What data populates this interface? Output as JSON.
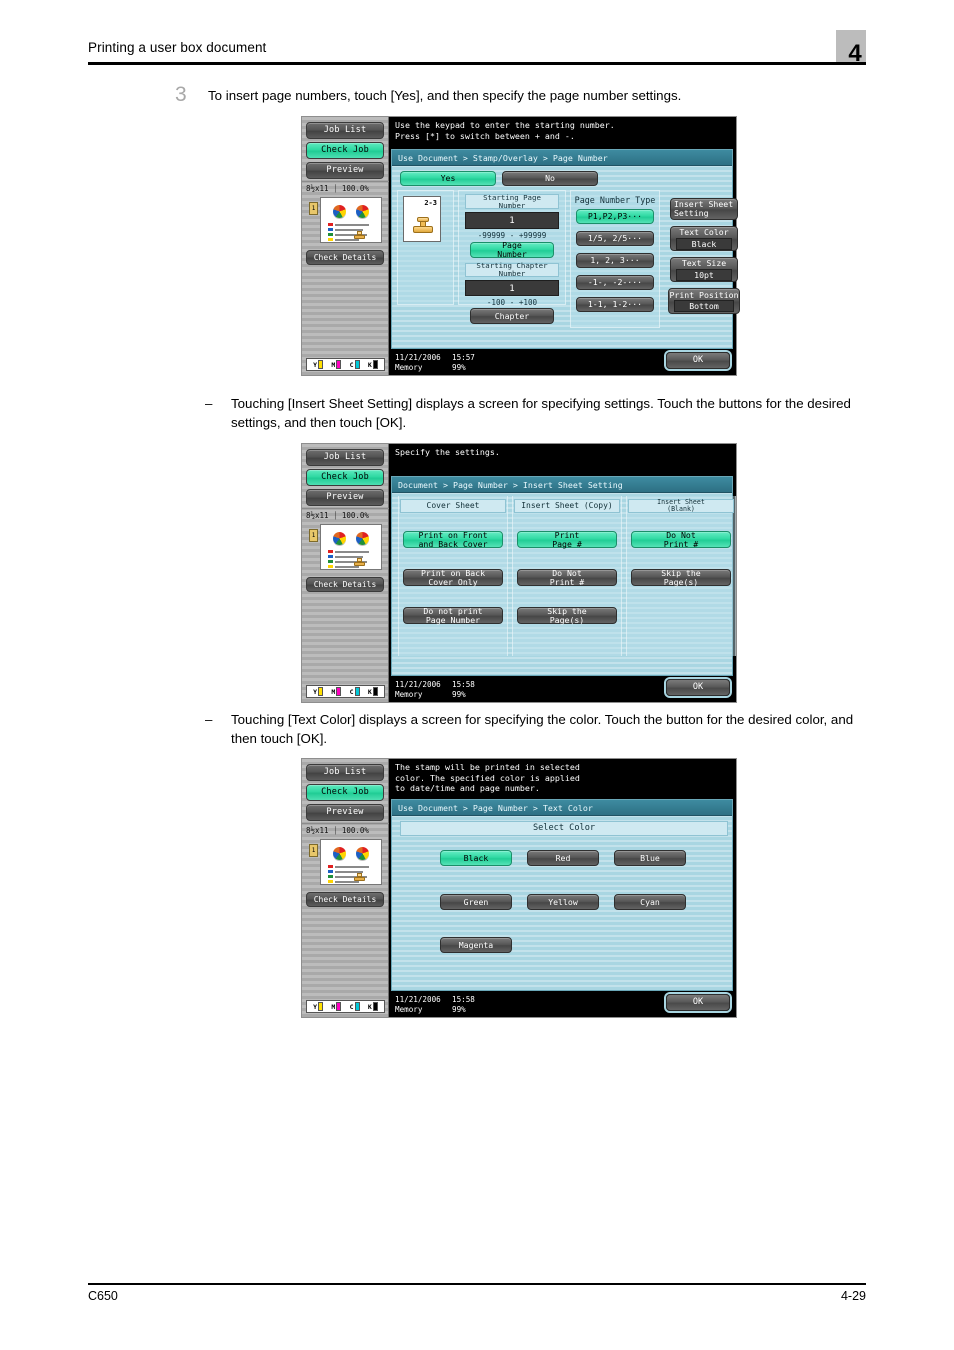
{
  "header": {
    "title": "Printing a user box document",
    "chapter": "4"
  },
  "footer": {
    "model": "C650",
    "page": "4-29"
  },
  "step": {
    "number": "3",
    "text": "To insert page numbers, touch [Yes], and then specify the page number settings."
  },
  "bullets": [
    {
      "dash": "–",
      "text": "Touching [Insert Sheet Setting] displays a screen for specifying settings. Touch the buttons for the desired settings, and then touch [OK]."
    },
    {
      "dash": "–",
      "text": "Touching [Text Color] displays a screen for specifying the color. Touch the button for the desired color, and then touch [OK]."
    }
  ],
  "colors": {
    "accent_green": "#2fd9a2",
    "lcd_background": "#a9d6e2",
    "breadcrumb_bar": "#3e8ba0",
    "button_gray": "#585858"
  },
  "rail": {
    "job_list": "Job List",
    "check_job": "Check Job",
    "preview": "Preview",
    "status": "8½x11 ⏐ 100.0%",
    "check_details": "Check Details",
    "toner": [
      {
        "label": "Y",
        "color": "#ffe000"
      },
      {
        "label": "M",
        "color": "#ff00c0"
      },
      {
        "label": "C",
        "color": "#00c8d8"
      },
      {
        "label": "K",
        "color": "#000000"
      }
    ]
  },
  "panel1": {
    "message": "Use the keypad to enter the starting number.\nPress [*] to switch between + and -.",
    "breadcrumb": "Use Document > Stamp/Overlay > Page Number",
    "yes": "Yes",
    "no": "No",
    "preview_page_label": "2-3",
    "starting_page_number_label": "Starting Page\nNumber",
    "starting_page_number_value": "1",
    "starting_page_number_range": "-99999  -  +99999",
    "page_number_button": "Page\nNumber",
    "starting_chapter_number_label": "Starting Chapter\nNumber",
    "starting_chapter_number_value": "1",
    "starting_chapter_number_range": "-100  -  +100",
    "chapter_button": "Chapter",
    "page_number_type_label": "Page Number Type",
    "page_number_types": [
      "P1,P2,P3···",
      "1/5, 2/5···",
      "1, 2, 3···",
      "-1-, -2-···",
      "1-1, 1-2···"
    ],
    "selected_page_number_type": "P1,P2,P3···",
    "insert_sheet_setting": "Insert Sheet\nSetting",
    "text_color_label": "Text Color",
    "text_color_value": "Black",
    "text_size_label": "Text Size",
    "text_size_value": "10pt",
    "print_position_label": "Print Position",
    "print_position_value": "Bottom",
    "date": "11/21/2006",
    "time": "15:57",
    "memory_label": "Memory",
    "memory_value": "99%",
    "ok": "OK"
  },
  "panel2": {
    "message": "Specify the settings.",
    "breadcrumb": "Document > Page Number > Insert Sheet Setting",
    "columns": [
      {
        "header": "Cover Sheet",
        "buttons": [
          {
            "label": "Print on Front\nand Back Cover",
            "selected": true
          },
          {
            "label": "Print on Back\nCover Only",
            "selected": false
          },
          {
            "label": "Do not print\nPage Number",
            "selected": false
          }
        ]
      },
      {
        "header": "Insert Sheet (Copy)",
        "buttons": [
          {
            "label": "Print\nPage #",
            "selected": true
          },
          {
            "label": "Do Not\nPrint #",
            "selected": false
          },
          {
            "label": "Skip the\nPage(s)",
            "selected": false
          }
        ]
      },
      {
        "header": "Insert Sheet\n(Blank)",
        "buttons": [
          {
            "label": "Do Not\nPrint #",
            "selected": true
          },
          {
            "label": "Skip the\nPage(s)",
            "selected": false
          }
        ]
      }
    ],
    "date": "11/21/2006",
    "time": "15:58",
    "memory_label": "Memory",
    "memory_value": "99%",
    "ok": "OK"
  },
  "panel3": {
    "message": "The stamp will be printed in selected\ncolor. The specified color is applied\nto date/time and page number.",
    "breadcrumb": "Use Document > Page Number > Text Color",
    "section_title": "Select Color",
    "colors": [
      {
        "label": "Black",
        "selected": true
      },
      {
        "label": "Red",
        "selected": false
      },
      {
        "label": "Blue",
        "selected": false
      },
      {
        "label": "Green",
        "selected": false
      },
      {
        "label": "Yellow",
        "selected": false
      },
      {
        "label": "Cyan",
        "selected": false
      },
      {
        "label": "Magenta",
        "selected": false
      }
    ],
    "date": "11/21/2006",
    "time": "15:58",
    "memory_label": "Memory",
    "memory_value": "99%",
    "ok": "OK"
  }
}
